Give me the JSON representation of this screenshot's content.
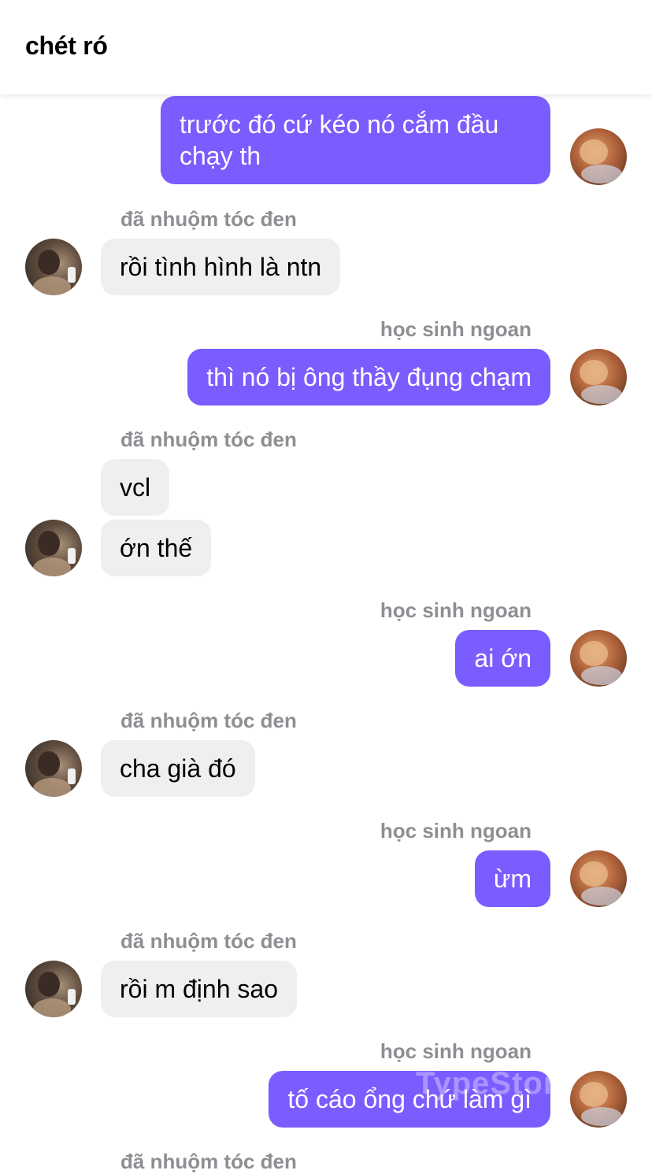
{
  "header": {
    "title": "chét ró"
  },
  "watermark": "TypeStory",
  "messages": [
    {
      "side": "right",
      "text": "trước đó cứ kéo nó cắm đầu chạy th"
    },
    {
      "side": "left",
      "sender": "đã nhuộm tóc đen",
      "text": "rồi tình hình là ntn"
    },
    {
      "side": "right",
      "sender": "học sinh ngoan",
      "text": "thì nó bị ông thầy đụng chạm"
    },
    {
      "side": "left",
      "sender": "đã nhuộm tóc đen",
      "text": "vcl"
    },
    {
      "side": "left",
      "text": "ớn thế"
    },
    {
      "side": "right",
      "sender": "học sinh ngoan",
      "text": "ai ớn"
    },
    {
      "side": "left",
      "sender": "đã nhuộm tóc đen",
      "text": "cha già đó"
    },
    {
      "side": "right",
      "sender": "học sinh ngoan",
      "text": "ừm"
    },
    {
      "side": "left",
      "sender": "đã nhuộm tóc đen",
      "text": "rồi m định sao"
    },
    {
      "side": "right",
      "sender": "học sinh ngoan",
      "text": "tố cáo ổng chứ làm gì"
    },
    {
      "side": "left",
      "sender": "đã nhuộm tóc đen"
    }
  ],
  "colors": {
    "outgoing_bubble": "#7b5cff",
    "incoming_bubble": "#efeff1",
    "sender_name": "#8e8e93"
  }
}
